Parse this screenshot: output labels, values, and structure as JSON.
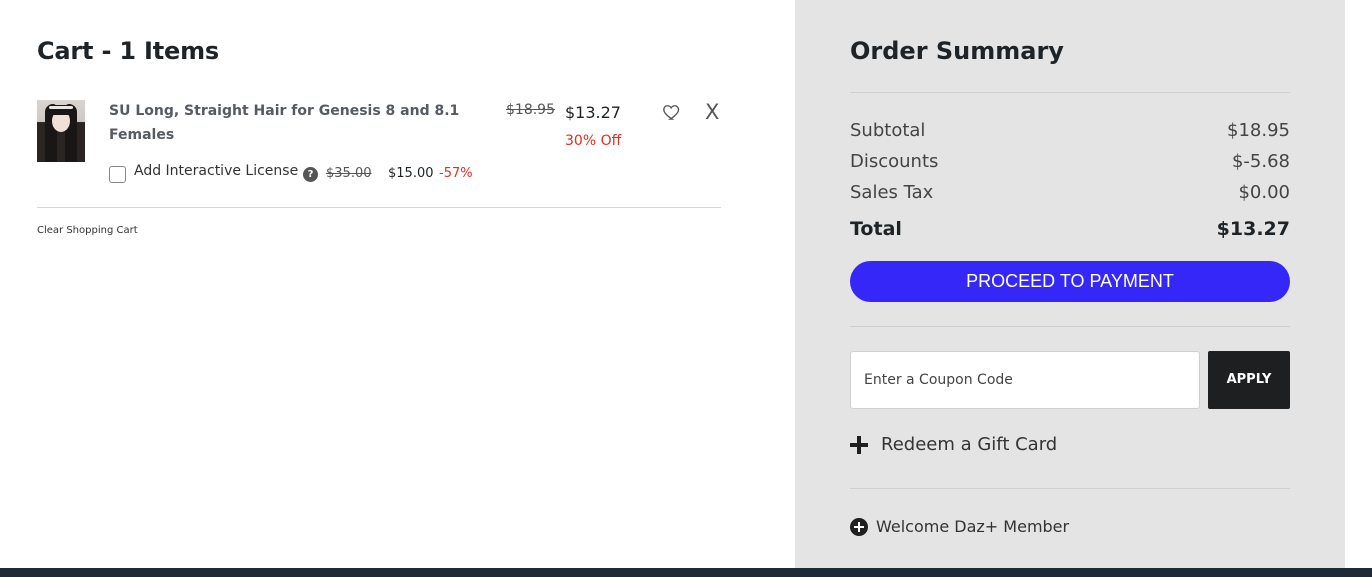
{
  "cart": {
    "title": "Cart - 1 Items",
    "items": [
      {
        "name": "SU Long, Straight Hair for Genesis 8 and 8.1 Females",
        "original_price": "$18.95",
        "sale_price": "$13.27",
        "discount_label": "30% Off",
        "license": {
          "label": "Add Interactive License",
          "help_icon": "?",
          "original_price": "$35.00",
          "sale_price": "$15.00",
          "discount": "-57%",
          "checked": false
        },
        "wishlist_icon": "heart-icon",
        "remove_label": "X"
      }
    ],
    "clear_label": "Clear Shopping Cart"
  },
  "summary": {
    "title": "Order Summary",
    "subtotal_label": "Subtotal",
    "subtotal_value": "$18.95",
    "discounts_label": "Discounts",
    "discounts_value": "$-5.68",
    "tax_label": "Sales Tax",
    "tax_value": "$0.00",
    "total_label": "Total",
    "total_value": "$13.27",
    "pay_label": "PROCEED TO PAYMENT",
    "coupon_placeholder": "Enter a Coupon Code",
    "apply_label": "APPLY",
    "gift_label": "Redeem a Gift Card",
    "member_label": "Welcome Daz+ Member"
  },
  "colors": {
    "accent": "#3527f7",
    "discount": "#e0301e",
    "summary_bg": "#e4e4e4",
    "footer_bar": "#1e2a38"
  }
}
